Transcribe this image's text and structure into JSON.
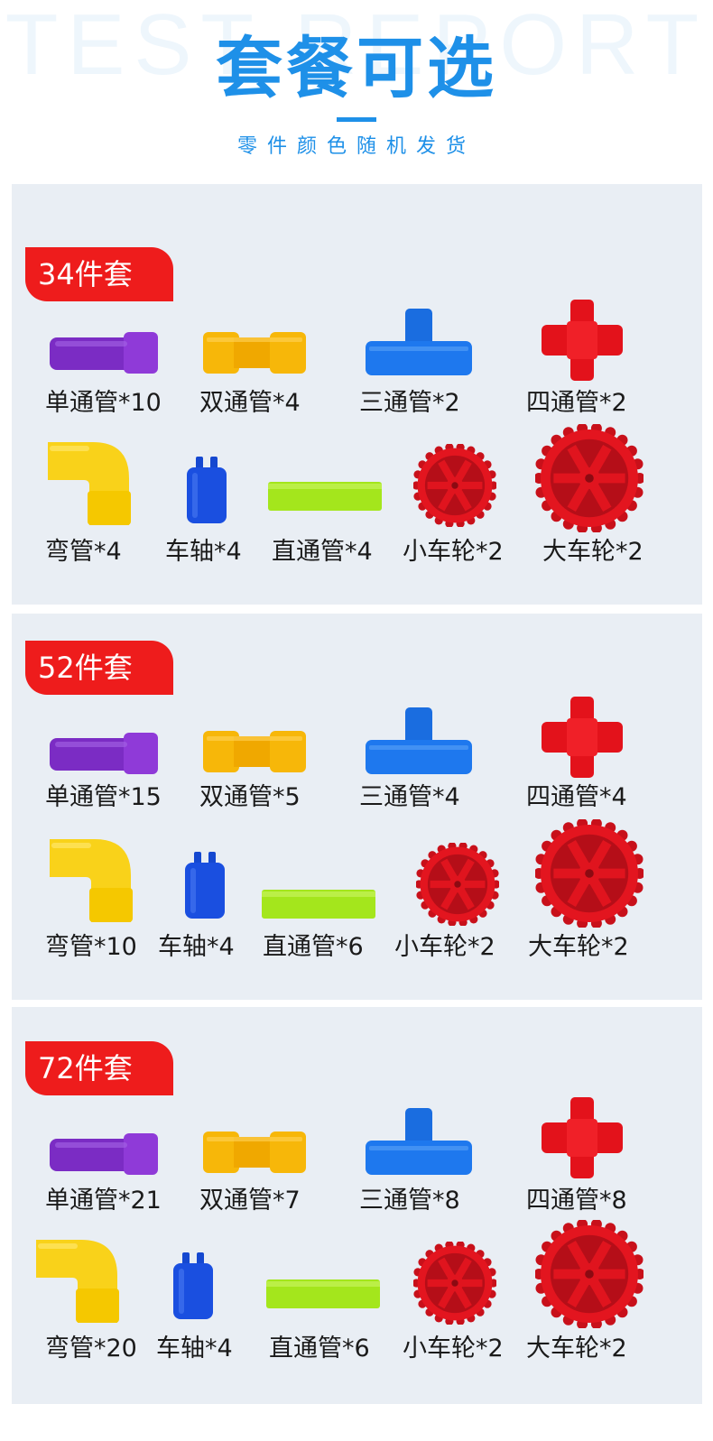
{
  "header": {
    "bg_text": "TEST REPORT",
    "title": "套餐可选",
    "subtitle": "零件颜色随机发货"
  },
  "colors": {
    "accent": "#1e90e8",
    "badge": "#ee1c1c",
    "panel": "#e9eef4"
  },
  "sets": [
    {
      "name": "34件套",
      "items": [
        {
          "label": "单通管*10",
          "icon": "purple-single-pipe-icon"
        },
        {
          "label": "双通管*4",
          "icon": "yellow-double-pipe-icon"
        },
        {
          "label": "三通管*2",
          "icon": "blue-tee-pipe-icon"
        },
        {
          "label": "四通管*2",
          "icon": "red-cross-pipe-icon"
        },
        {
          "label": "弯管*4",
          "icon": "yellow-elbow-pipe-icon"
        },
        {
          "label": "车轴*4",
          "icon": "blue-axle-icon"
        },
        {
          "label": "直通管*4",
          "icon": "green-straight-pipe-icon"
        },
        {
          "label": "小车轮*2",
          "icon": "small-red-wheel-icon"
        },
        {
          "label": "大车轮*2",
          "icon": "large-red-wheel-icon"
        }
      ]
    },
    {
      "name": "52件套",
      "items": [
        {
          "label": "单通管*15",
          "icon": "purple-single-pipe-icon"
        },
        {
          "label": "双通管*5",
          "icon": "yellow-double-pipe-icon"
        },
        {
          "label": "三通管*4",
          "icon": "blue-tee-pipe-icon"
        },
        {
          "label": "四通管*4",
          "icon": "red-cross-pipe-icon"
        },
        {
          "label": "弯管*10",
          "icon": "yellow-elbow-pipe-icon"
        },
        {
          "label": "车轴*4",
          "icon": "blue-axle-icon"
        },
        {
          "label": "直通管*6",
          "icon": "green-straight-pipe-icon"
        },
        {
          "label": "小车轮*2",
          "icon": "small-red-wheel-icon"
        },
        {
          "label": "大车轮*2",
          "icon": "large-red-wheel-icon"
        }
      ]
    },
    {
      "name": "72件套",
      "items": [
        {
          "label": "单通管*21",
          "icon": "purple-single-pipe-icon"
        },
        {
          "label": "双通管*7",
          "icon": "yellow-double-pipe-icon"
        },
        {
          "label": "三通管*8",
          "icon": "blue-tee-pipe-icon"
        },
        {
          "label": "四通管*8",
          "icon": "red-cross-pipe-icon"
        },
        {
          "label": "弯管*20",
          "icon": "yellow-elbow-pipe-icon"
        },
        {
          "label": "车轴*4",
          "icon": "blue-axle-icon"
        },
        {
          "label": "直通管*6",
          "icon": "green-straight-pipe-icon"
        },
        {
          "label": "小车轮*2",
          "icon": "small-red-wheel-icon"
        },
        {
          "label": "大车轮*2",
          "icon": "large-red-wheel-icon"
        }
      ]
    }
  ]
}
